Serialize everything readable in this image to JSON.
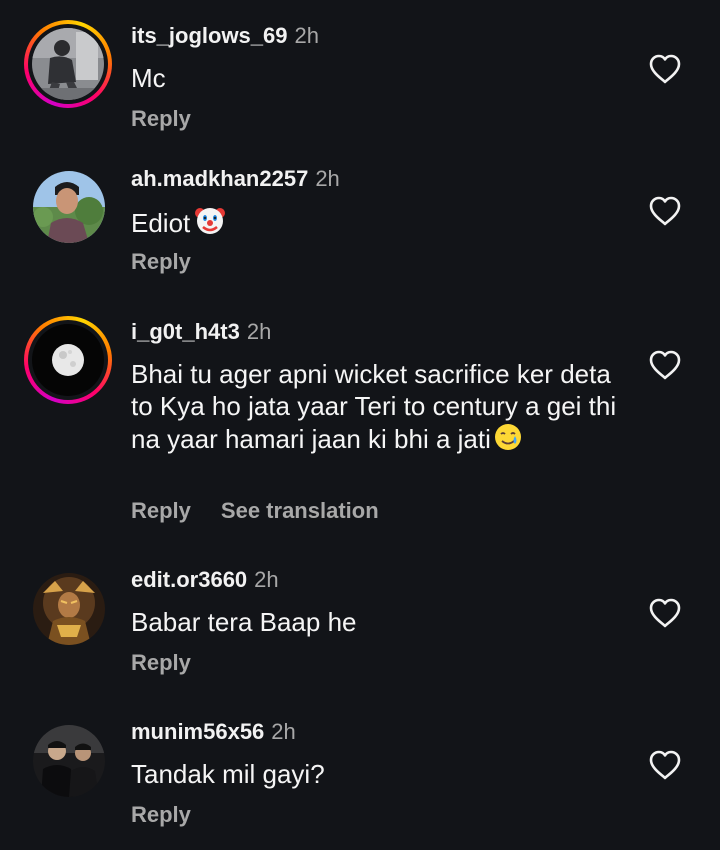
{
  "comments": [
    {
      "username": "its_joglows_69",
      "time": "2h",
      "text": "Mc",
      "reply_label": "Reply",
      "has_story_ring": true,
      "avatar": "person-portrait-gray"
    },
    {
      "username": "ah.madkhan2257",
      "time": "2h",
      "text": "Ediot",
      "emoji": "clown-face-emoji",
      "reply_label": "Reply",
      "has_story_ring": false,
      "avatar": "person-portrait-outdoor"
    },
    {
      "username": "i_g0t_h4t3",
      "time": "2h",
      "text": "Bhai tu ager apni wicket sacrifice ker deta to Kya ho jata yaar Teri to century a gei thi na yaar hamari jaan ki bhi a jati",
      "emoji": "smiling-face-with-tear-emoji",
      "reply_label": "Reply",
      "see_translation_label": "See translation",
      "has_story_ring": true,
      "avatar": "full-moon"
    },
    {
      "username": "edit.or3660",
      "time": "2h",
      "text": "Babar tera Baap he",
      "reply_label": "Reply",
      "has_story_ring": false,
      "avatar": "warrior-artwork"
    },
    {
      "username": "munim56x56",
      "time": "2h",
      "text": "Tandak mil gayi?",
      "reply_label": "Reply",
      "has_story_ring": false,
      "avatar": "two-people-dark"
    }
  ],
  "colors": {
    "background": "#121418",
    "username": "#f2f2f2",
    "secondary_text": "#a8a8a8",
    "comment_text": "#f5f5f5"
  },
  "icons": {
    "like": "heart-outline-icon"
  }
}
